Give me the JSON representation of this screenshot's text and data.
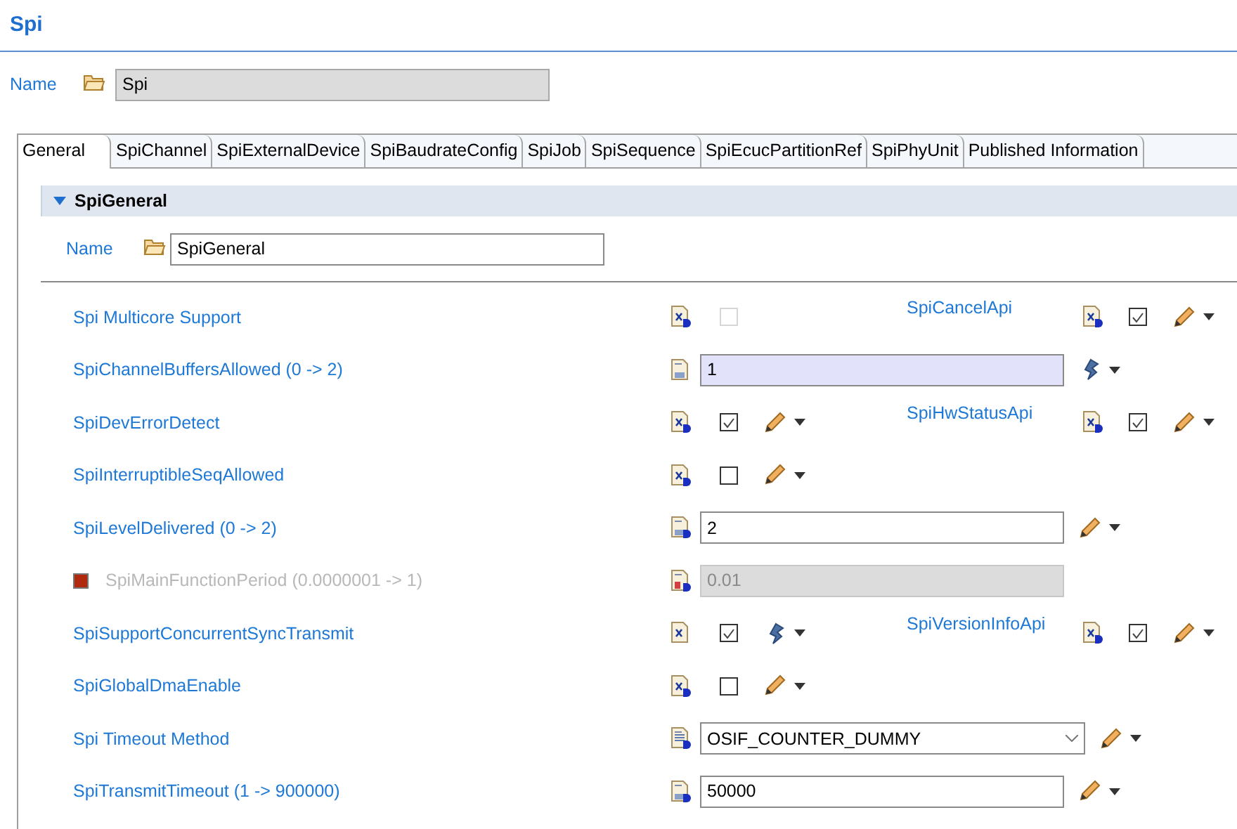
{
  "title": "Spi",
  "name": {
    "label": "Name",
    "value": "Spi"
  },
  "tabs": [
    {
      "label": "General",
      "selected": true
    },
    {
      "label": "SpiChannel",
      "selected": false
    },
    {
      "label": "SpiExternalDevice",
      "selected": false
    },
    {
      "label": "SpiBaudrateConfig",
      "selected": false
    },
    {
      "label": "SpiJob",
      "selected": false
    },
    {
      "label": "SpiSequence",
      "selected": false
    },
    {
      "label": "SpiEcucPartitionRef",
      "selected": false
    },
    {
      "label": "SpiPhyUnit",
      "selected": false
    },
    {
      "label": "Published Information",
      "selected": false
    }
  ],
  "section": {
    "title": "SpiGeneral",
    "expanded": true,
    "name_label": "Name",
    "name_value": "SpiGeneral"
  },
  "params": [
    {
      "label": "Spi Multicore Support",
      "kind": "checkbox",
      "checked": false,
      "disabled": true,
      "right": {
        "label": "SpiCancelApi",
        "checked": true
      }
    },
    {
      "label": "SpiChannelBuffersAllowed (0 -> 2)",
      "kind": "field",
      "value": "1",
      "highlighted": true,
      "disabled": false
    },
    {
      "label": "SpiDevErrorDetect",
      "kind": "checkbox",
      "checked": true,
      "disabled": false,
      "right": {
        "label": "SpiHwStatusApi",
        "checked": true
      }
    },
    {
      "label": "SpiInterruptibleSeqAllowed",
      "kind": "checkbox",
      "checked": false,
      "disabled": false
    },
    {
      "label": "SpiLevelDelivered (0 -> 2)",
      "kind": "field",
      "value": "2",
      "highlighted": false,
      "disabled": false
    },
    {
      "label": "SpiMainFunctionPeriod (0.0000001 -> 1)",
      "kind": "field",
      "value": "0.01",
      "highlighted": false,
      "disabled": true,
      "marker": true
    },
    {
      "label": "SpiSupportConcurrentSyncTransmit",
      "kind": "checkbox",
      "checked": true,
      "disabled": false,
      "right": {
        "label": "SpiVersionInfoApi",
        "checked": true
      }
    },
    {
      "label": "SpiGlobalDmaEnable",
      "kind": "checkbox",
      "checked": false,
      "disabled": false
    },
    {
      "label": "Spi Timeout Method",
      "kind": "combo",
      "value": "OSIF_COUNTER_DUMMY"
    },
    {
      "label": "SpiTransmitTimeout (1 -> 900000)",
      "kind": "field",
      "value": "50000",
      "highlighted": false,
      "disabled": false
    }
  ]
}
